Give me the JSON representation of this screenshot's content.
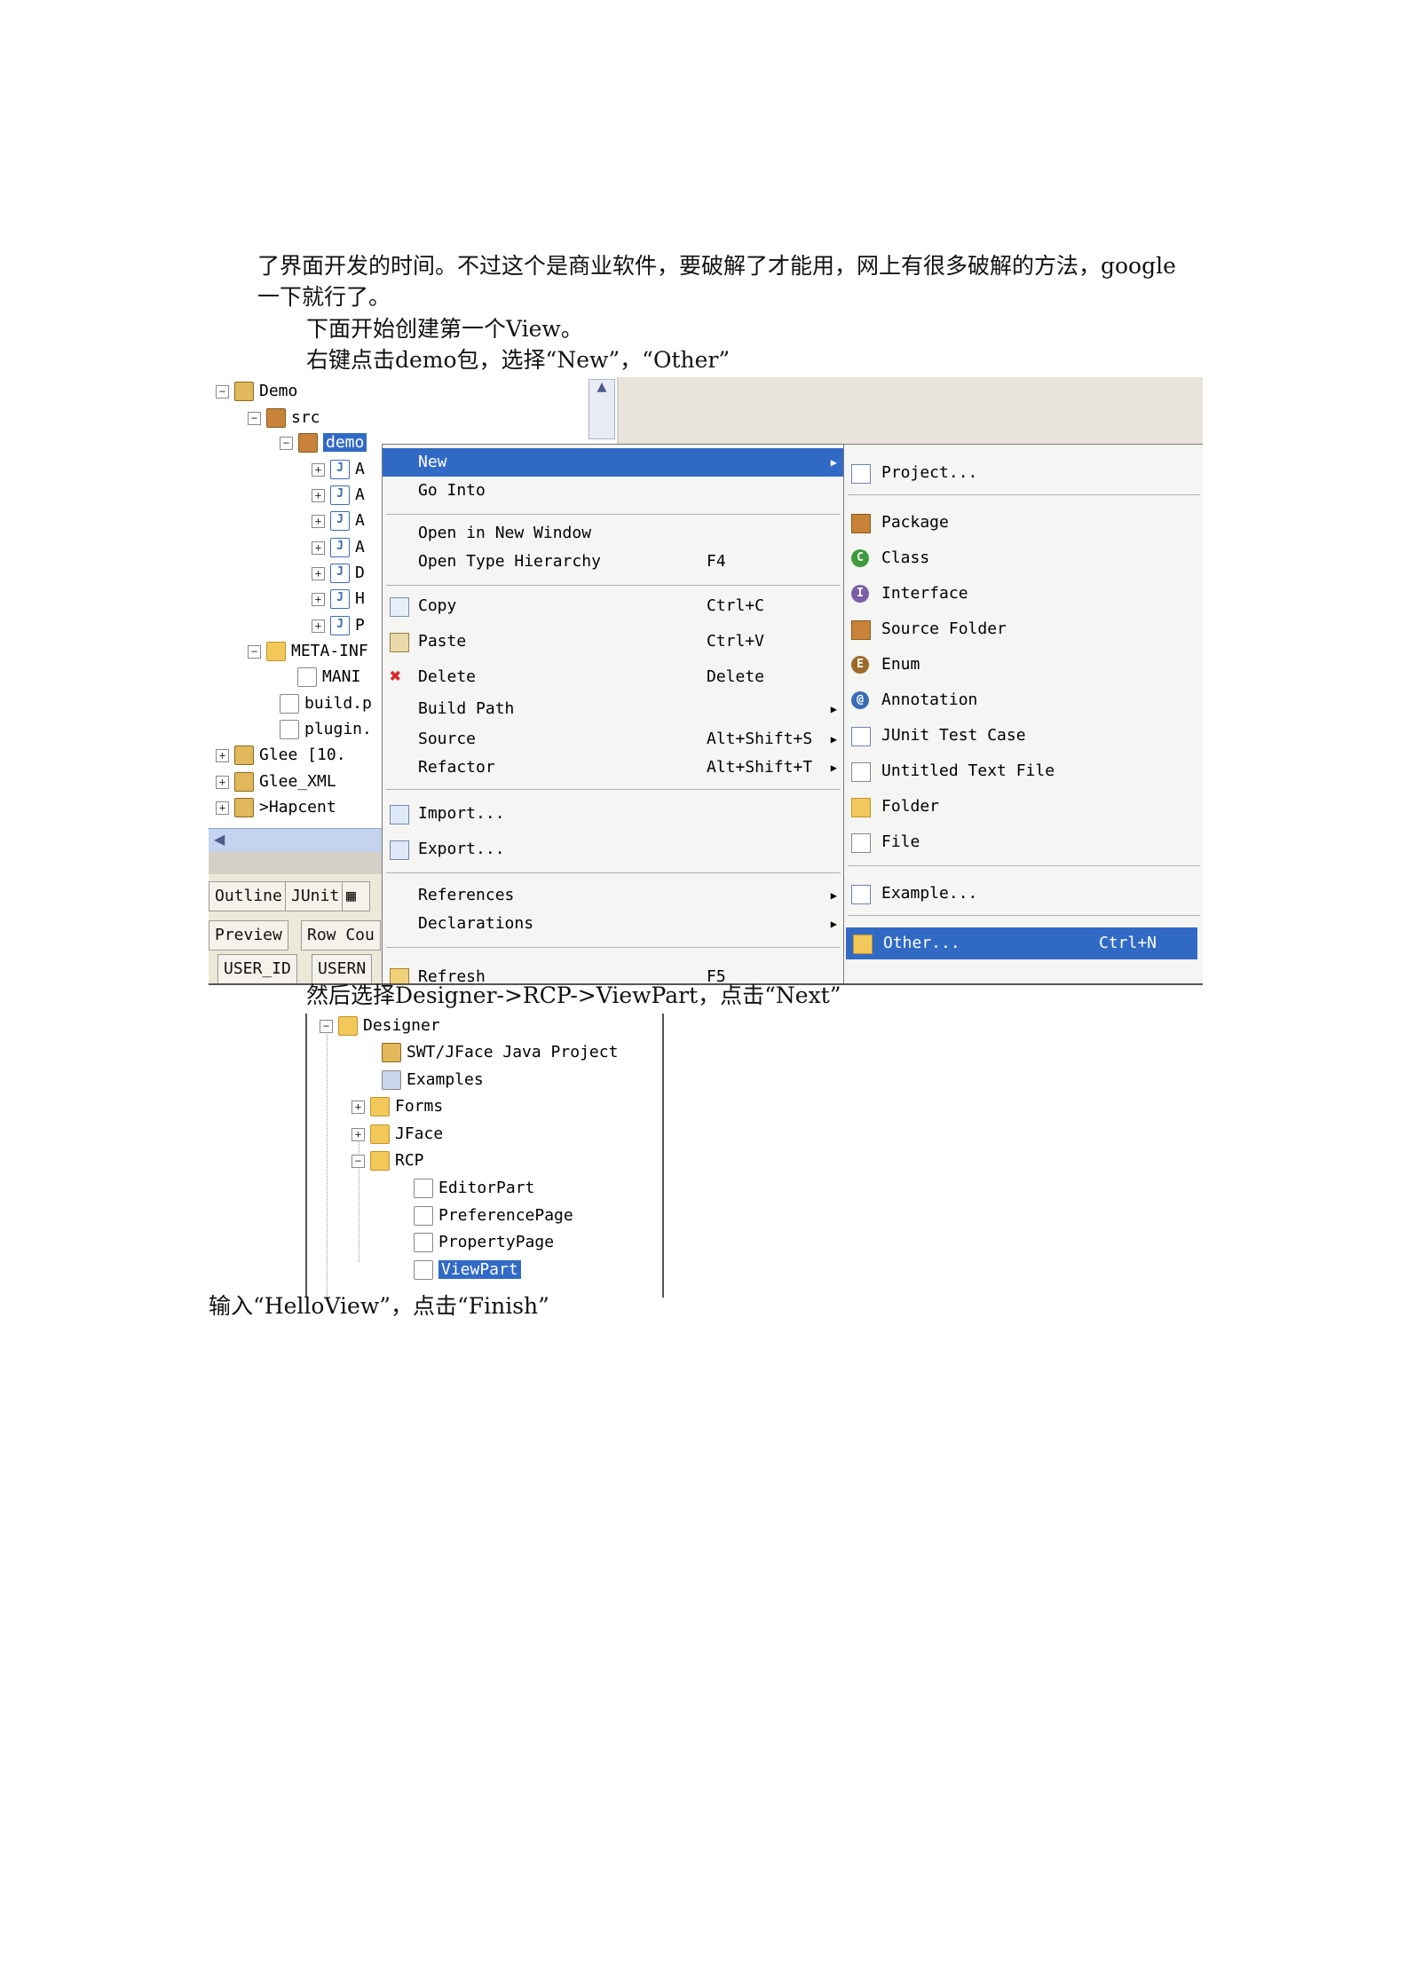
{
  "paragraphs": {
    "p1_line1": "了界面开发的时间。不过这个是商业软件，要破解了才能用，网上有很多破解的方法，google",
    "p1_line2": "一下就行了。",
    "p2": "下面开始创建第一个View。",
    "p3": "右键点击demo包，选择“New”，“Other”",
    "p4": "然后选择Designer->RCP->ViewPart，点击“Next”",
    "p5": "输入“HelloView”，点击“Finish”"
  },
  "explorer": {
    "rows": [
      {
        "label": "Demo"
      },
      {
        "label": "src"
      },
      {
        "label": "demo"
      },
      {
        "label": "A"
      },
      {
        "label": "A"
      },
      {
        "label": "A"
      },
      {
        "label": "A"
      },
      {
        "label": "D"
      },
      {
        "label": "H"
      },
      {
        "label": "P"
      },
      {
        "label": "META-INF"
      },
      {
        "label": "MANI"
      },
      {
        "label": "build.p"
      },
      {
        "label": "plugin."
      },
      {
        "label": "Glee    [10."
      },
      {
        "label": "Glee_XML"
      },
      {
        "label": ">Hapcent"
      }
    ],
    "tabs": {
      "outline": "Outline",
      "junit": "JUnit",
      "preview": "Preview",
      "rowcount": "Row Cou",
      "col1": "USER_ID",
      "col2": "USERN"
    }
  },
  "context_menu": {
    "new": "New",
    "go_into": "Go Into",
    "open_new_window": "Open in New Window",
    "open_type_hierarchy": "Open Type Hierarchy",
    "open_type_hierarchy_sc": "F4",
    "copy": "Copy",
    "copy_sc": "Ctrl+C",
    "paste": "Paste",
    "paste_sc": "Ctrl+V",
    "delete": "Delete",
    "delete_sc": "Delete",
    "build_path": "Build Path",
    "source": "Source",
    "source_sc": "Alt+Shift+S",
    "refactor": "Refactor",
    "refactor_sc": "Alt+Shift+T",
    "import": "Import...",
    "export": "Export...",
    "references": "References",
    "declarations": "Declarations",
    "refresh": "Refresh",
    "refresh_sc": "F5"
  },
  "new_submenu": {
    "project": "Project...",
    "package": "Package",
    "class": "Class",
    "interface": "Interface",
    "source_folder": "Source Folder",
    "enum": "Enum",
    "annotation": "Annotation",
    "junit_test_case": "JUnit Test Case",
    "untitled_text_file": "Untitled Text File",
    "folder": "Folder",
    "file": "File",
    "example": "Example...",
    "other": "Other...",
    "other_sc": "Ctrl+N"
  },
  "wizard_tree": {
    "designer": "Designer",
    "swt_jface": "SWT/JFace Java Project",
    "examples": "Examples",
    "forms": "Forms",
    "jface": "JFace",
    "rcp": "RCP",
    "editorpart": "EditorPart",
    "preferencepage": "PreferencePage",
    "propertypage": "PropertyPage",
    "viewpart": "ViewPart"
  },
  "colors": {
    "selection": "#316ac5",
    "window_bg": "#d4d0c8",
    "menu_bg": "#f5f5f3"
  }
}
